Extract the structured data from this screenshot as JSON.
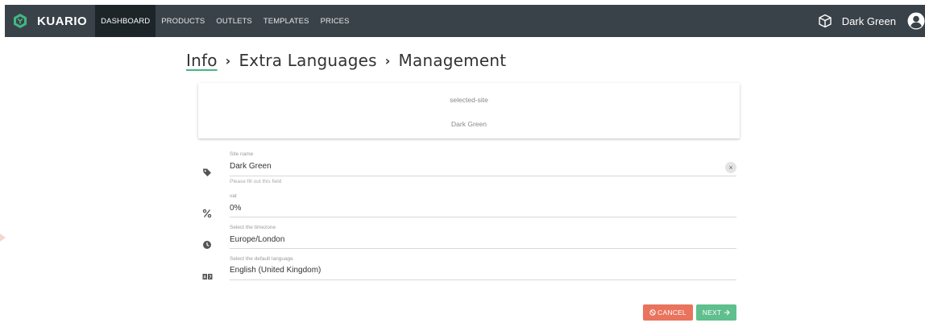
{
  "app": {
    "brand": "KUARIO",
    "accent_color": "#41b883",
    "navbar_color": "#3a4249"
  },
  "nav": {
    "items": [
      {
        "label": "DASHBOARD",
        "active": true
      },
      {
        "label": "PRODUCTS",
        "active": false
      },
      {
        "label": "OUTLETS",
        "active": false
      },
      {
        "label": "TEMPLATES",
        "active": false
      },
      {
        "label": "PRICES",
        "active": false
      }
    ],
    "site_icon": "cube-icon",
    "site_label": "Dark Green",
    "user_icon": "user-icon"
  },
  "breadcrumb": {
    "items": [
      "Info",
      "Extra Languages",
      "Management"
    ],
    "separator": "›"
  },
  "site_card": {
    "key": "selected-site",
    "value": "Dark Green"
  },
  "form": {
    "site_name": {
      "label": "Site name",
      "value": "Dark Green",
      "hint": "Please fill out this field",
      "icon": "tag-icon"
    },
    "vat": {
      "label": "vat",
      "value": "0%",
      "icon": "percent-icon"
    },
    "timezone": {
      "label": "Select the timezone",
      "value": "Europe/London",
      "icon": "clock-icon"
    },
    "language": {
      "label": "Select the default language",
      "value": "English (United Kingdom)",
      "icon": "translate-icon"
    }
  },
  "actions": {
    "cancel_label": "CANCEL",
    "next_label": "NEXT",
    "cancel_color": "#e9735c",
    "next_color": "#5fbf8d"
  }
}
